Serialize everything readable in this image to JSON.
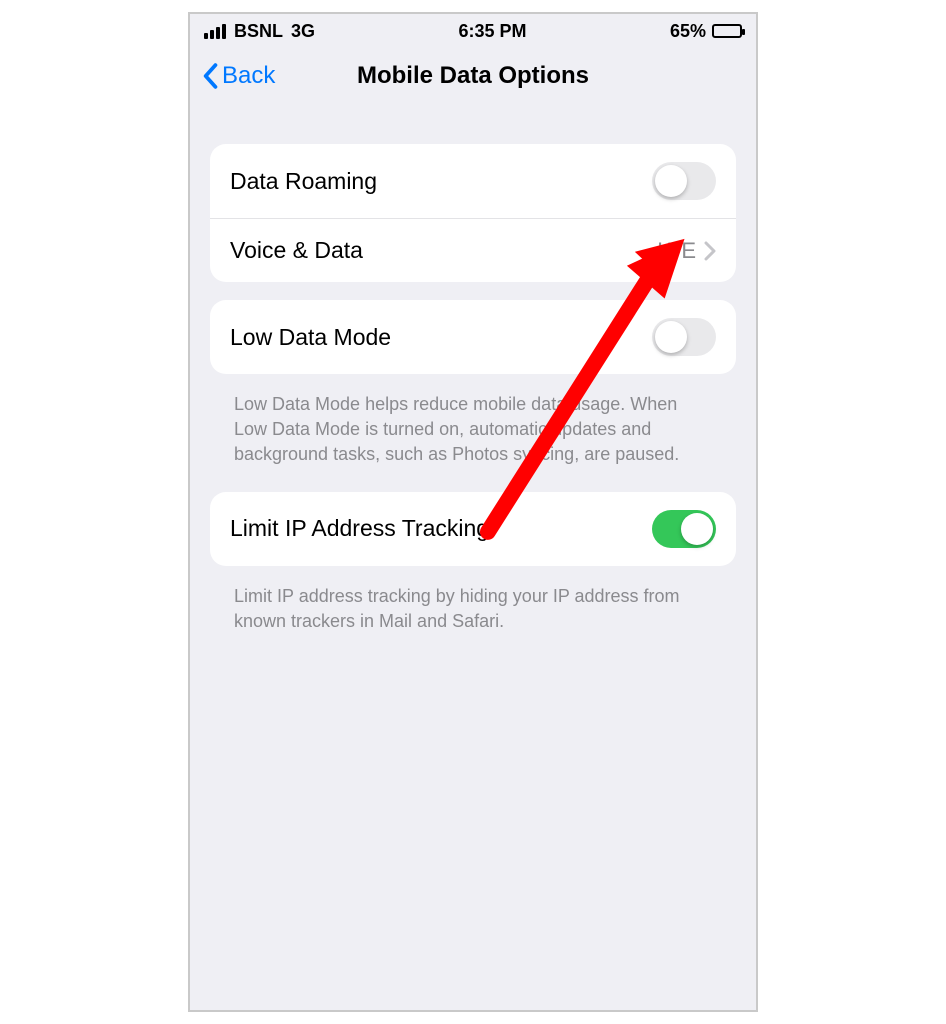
{
  "status": {
    "carrier": "BSNL",
    "network": "3G",
    "time": "6:35 PM",
    "battery_pct": "65%"
  },
  "nav": {
    "back_label": "Back",
    "title": "Mobile Data Options"
  },
  "groups": {
    "g1": {
      "data_roaming_label": "Data Roaming",
      "voice_data_label": "Voice & Data",
      "voice_data_value": "LTE"
    },
    "g2": {
      "low_data_label": "Low Data Mode",
      "low_data_footer": "Low Data Mode helps reduce mobile data usage. When Low Data Mode is turned on, automatic updates and background tasks, such as Photos syncing, are paused."
    },
    "g3": {
      "limit_ip_label": "Limit IP Address Tracking",
      "limit_ip_footer": "Limit IP address tracking by hiding your IP address from known trackers in Mail and Safari."
    }
  },
  "toggles": {
    "data_roaming_on": false,
    "low_data_on": false,
    "limit_ip_on": true
  },
  "colors": {
    "accent": "#0078ff",
    "toggle_on": "#34c759",
    "annotation_arrow": "#ff0000"
  }
}
